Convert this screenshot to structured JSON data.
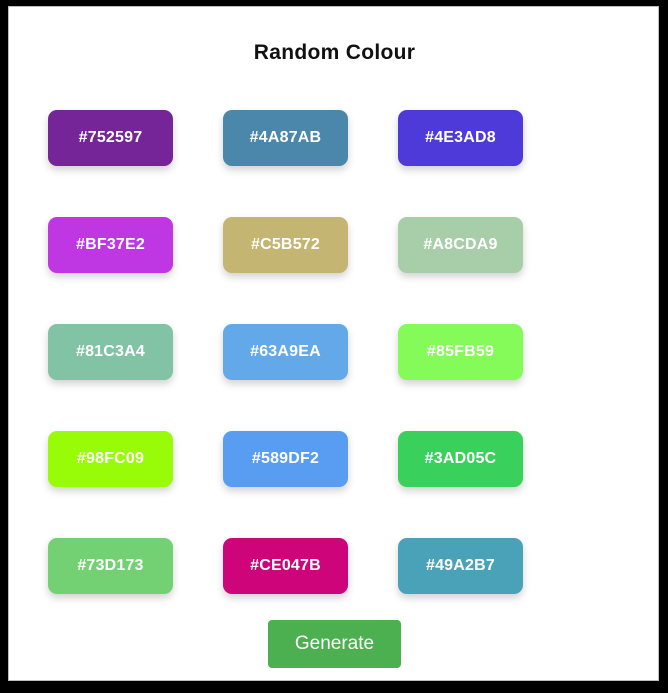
{
  "title": "Random Colour",
  "swatches": [
    {
      "label": "#752597",
      "color": "#752597"
    },
    {
      "label": "#4A87AB",
      "color": "#4A87AB"
    },
    {
      "label": "#4E3AD8",
      "color": "#4E3AD8"
    },
    {
      "label": "#BF37E2",
      "color": "#BF37E2"
    },
    {
      "label": "#C5B572",
      "color": "#C5B572"
    },
    {
      "label": "#A8CDA9",
      "color": "#A8CDA9"
    },
    {
      "label": "#81C3A4",
      "color": "#81C3A4"
    },
    {
      "label": "#63A9EA",
      "color": "#63A9EA"
    },
    {
      "label": "#85FB59",
      "color": "#85FB59"
    },
    {
      "label": "#98FC09",
      "color": "#98FC09"
    },
    {
      "label": "#589DF2",
      "color": "#589DF2"
    },
    {
      "label": "#3AD05C",
      "color": "#3AD05C"
    },
    {
      "label": "#73D173",
      "color": "#73D173"
    },
    {
      "label": "#CE047B",
      "color": "#CE047B"
    },
    {
      "label": "#49A2B7",
      "color": "#49A2B7"
    }
  ],
  "generate_label": "Generate",
  "colors": {
    "button": "#4CAF50",
    "title_text": "#111111",
    "swatch_text": "#FFFFFF"
  }
}
